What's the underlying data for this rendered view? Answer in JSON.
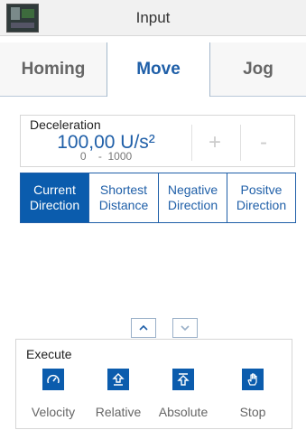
{
  "header": {
    "title": "Input"
  },
  "tabs": [
    {
      "label": "Homing",
      "active": false
    },
    {
      "label": "Move",
      "active": true
    },
    {
      "label": "Jog",
      "active": false
    }
  ],
  "deceleration": {
    "label": "Deceleration",
    "value": "100,00 U/s²",
    "range": "0    -  1000",
    "plus_label": "+",
    "minus_label": "-"
  },
  "directions": [
    {
      "label": "Current Direction",
      "active": true
    },
    {
      "label": "Shortest Distance",
      "active": false
    },
    {
      "label": "Negative Direction",
      "active": false
    },
    {
      "label": "Positve Direction",
      "active": false
    }
  ],
  "scroll": {
    "up_icon": "chevron-up-icon",
    "down_icon": "chevron-down-icon"
  },
  "execute": {
    "title": "Execute",
    "buttons": [
      {
        "label": "Velocity",
        "icon": "gauge-icon"
      },
      {
        "label": "Relative",
        "icon": "arrow-up-bar-icon"
      },
      {
        "label": "Absolute",
        "icon": "arrow-up-top-bar-icon"
      },
      {
        "label": "Stop",
        "icon": "hand-icon"
      }
    ]
  },
  "colors": {
    "accent": "#0b5cad",
    "accent_text": "#1f5fa8",
    "inactive_text": "#666666"
  }
}
